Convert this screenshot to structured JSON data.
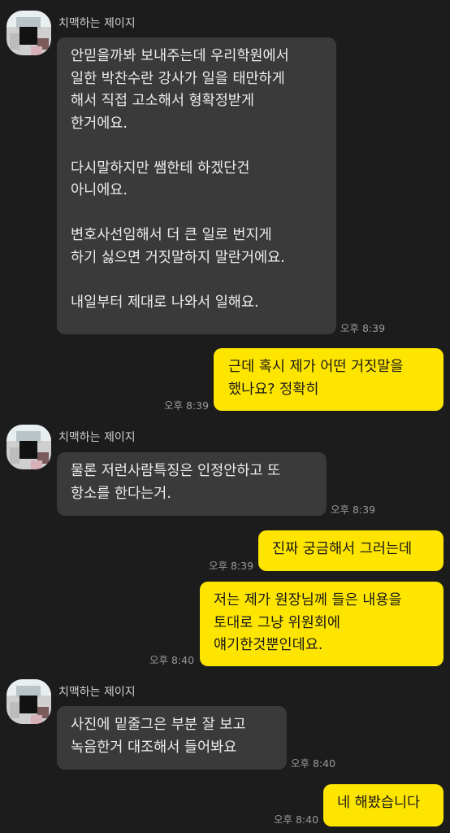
{
  "chat": {
    "sender_name": "치맥하는 제이지",
    "messages": [
      {
        "from": "them",
        "text": "안믿을까봐 보내주는데 우리학원에서\n일한 박찬수란 강사가 일을 태만하게\n해서 직접 고소해서 형확정받게\n한거에요.\n\n다시말하지만 쌤한테 하겠단건\n아니에요.\n\n변호사선임해서 더 큰 일로 번지게\n하기 싫으면 거짓말하지 말란거에요.\n\n내일부터 제대로 나와서 일해요.",
        "time": "오후 8:39"
      },
      {
        "from": "me",
        "text": "근데 혹시 제가 어떤 거짓말을\n했나요? 정확히",
        "time": "오후 8:39"
      },
      {
        "from": "them",
        "text": "물론 저런사람특징은 인정안하고 또\n항소를 한다는거.",
        "time": "오후 8:39"
      },
      {
        "from": "me",
        "text": "진짜 궁금해서 그러는데",
        "time": "오후 8:39"
      },
      {
        "from": "me",
        "text": "저는 제가 원장님께 들은 내용을\n토대로 그냥 위원회에\n얘기한것뿐인데요.",
        "time": "오후 8:40"
      },
      {
        "from": "them",
        "text": "사진에 밑줄그은 부분 잘 보고\n녹음한거 대조해서 들어봐요",
        "time": "오후 8:40"
      },
      {
        "from": "me",
        "text": "네 해봤습니다",
        "time": "오후 8:40"
      }
    ]
  },
  "colors": {
    "background": "#1c1c1c",
    "incoming_bubble": "#3a3a3a",
    "outgoing_bubble": "#fee500",
    "timestamp": "#9a9a9a"
  },
  "icons": {
    "avatar": "pixelated-profile-avatar-icon"
  }
}
